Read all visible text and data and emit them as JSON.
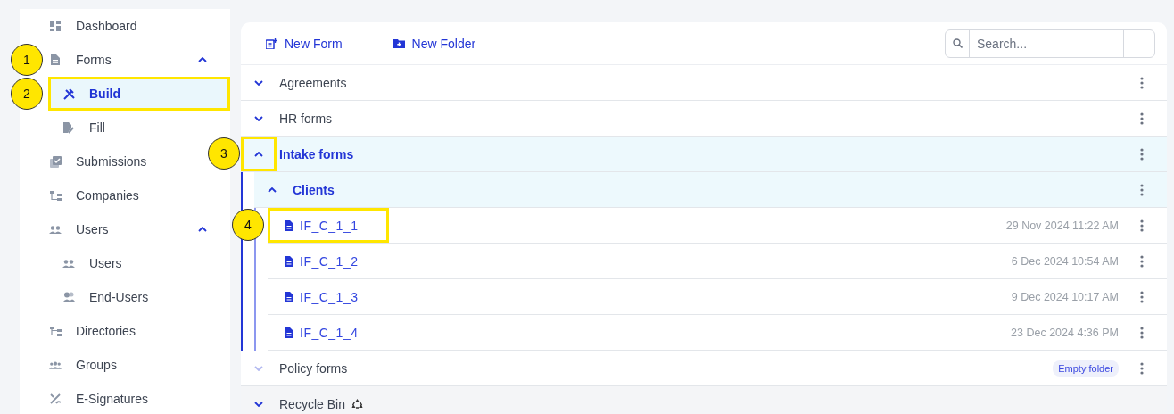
{
  "sidebar": {
    "items": [
      {
        "label": "Dashboard",
        "selected": false
      },
      {
        "label": "Forms",
        "selected": false,
        "expanded": true,
        "callout": "1",
        "highlighted": false,
        "children": [
          {
            "label": "Build",
            "selected": true,
            "callout": "2",
            "highlighted": true
          },
          {
            "label": "Fill",
            "selected": false
          }
        ]
      },
      {
        "label": "Submissions",
        "selected": false
      },
      {
        "label": "Companies",
        "selected": false
      },
      {
        "label": "Users",
        "selected": false,
        "expanded": true,
        "children": [
          {
            "label": "Users",
            "selected": false
          },
          {
            "label": "End-Users",
            "selected": false
          }
        ]
      },
      {
        "label": "Directories",
        "selected": false
      },
      {
        "label": "Groups",
        "selected": false
      },
      {
        "label": "E-Signatures",
        "selected": false
      }
    ]
  },
  "toolbar": {
    "buttons": [
      {
        "label": "New Form"
      },
      {
        "label": "New Folder"
      }
    ],
    "search": {
      "placeholder": "Search..."
    }
  },
  "tree": [
    {
      "kind": "folder",
      "name": "Agreements",
      "expanded": false,
      "selected": false
    },
    {
      "kind": "folder",
      "name": "HR forms",
      "expanded": false,
      "selected": false
    },
    {
      "kind": "folder",
      "name": "Intake forms",
      "expanded": true,
      "selected": true,
      "callout": "3",
      "highlighted": true,
      "children": [
        {
          "kind": "folder",
          "name": "Clients",
          "expanded": true,
          "selected": true,
          "children": [
            {
              "kind": "file",
              "name": "IF_C_1_1",
              "date": "29 Nov 2024 11:22 AM",
              "callout": "4",
              "highlighted": true
            },
            {
              "kind": "file",
              "name": "IF_C_1_2",
              "date": "6 Dec 2024 10:54 AM"
            },
            {
              "kind": "file",
              "name": "IF_C_1_3",
              "date": "9 Dec 2024 10:17 AM"
            },
            {
              "kind": "file",
              "name": "IF_C_1_4",
              "date": "23 Dec 2024 4:36 PM"
            }
          ]
        }
      ]
    },
    {
      "kind": "folder",
      "name": "Policy forms",
      "expanded": false,
      "selected": false,
      "disabled": true,
      "badge": "Empty folder"
    },
    {
      "kind": "bin",
      "name": "Recycle Bin",
      "expanded": false,
      "selected": false
    }
  ]
}
